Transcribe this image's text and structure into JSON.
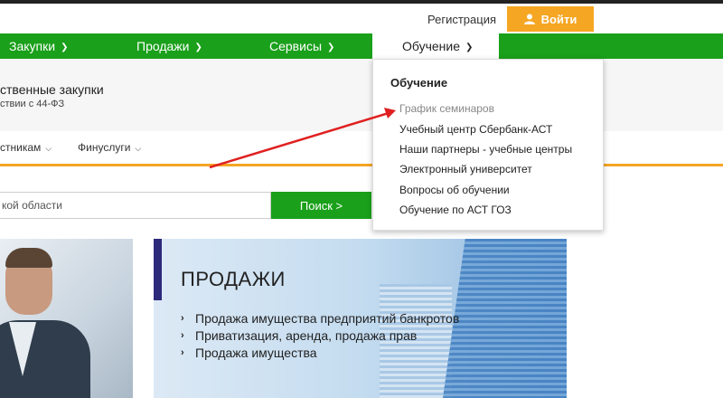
{
  "topbar": {
    "register": "Регистрация",
    "login": "Войти"
  },
  "nav": {
    "items": [
      {
        "label": "Закупки"
      },
      {
        "label": "Продажи"
      },
      {
        "label": "Сервисы"
      },
      {
        "label": "Обучение"
      }
    ]
  },
  "header": {
    "title": "ственные закупки",
    "subtitle": "ствии с 44-ФЗ"
  },
  "subnav": {
    "items": [
      {
        "label": "стникам"
      },
      {
        "label": "Финуслуги"
      }
    ]
  },
  "search": {
    "value": "кой области",
    "button": "Поиск >"
  },
  "hero": {
    "title": "ПРОДАЖИ",
    "list": [
      "Продажа имущества предприятий банкротов",
      "Приватизация, аренда, продажа прав",
      "Продажа имущества"
    ]
  },
  "dropdown": {
    "title": "Обучение",
    "items": [
      "График семинаров",
      "Учебный центр Сбербанк-АСТ",
      "Наши партнеры - учебные центры",
      "Электронный университет",
      "Вопросы об обучении",
      "Обучение по АСТ ГОЗ"
    ]
  },
  "colors": {
    "green": "#1aa01a",
    "orange": "#f5a623",
    "annotation_red": "#e02020"
  }
}
